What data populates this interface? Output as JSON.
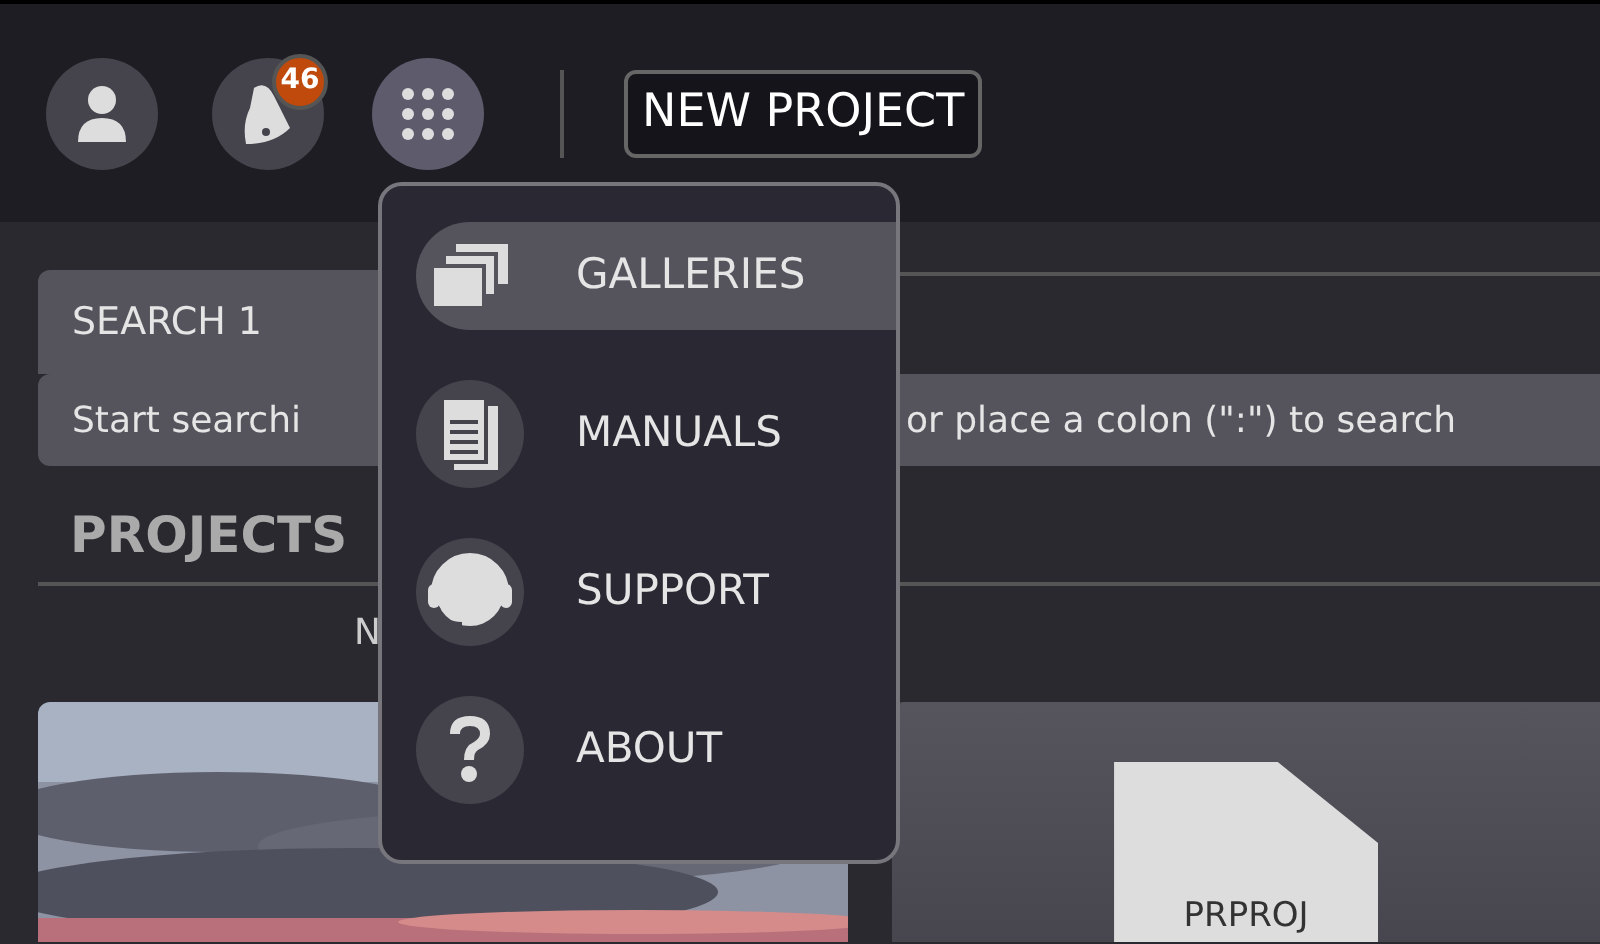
{
  "header": {
    "notification_count": "46",
    "new_project_button": "NEW PROJECT"
  },
  "search": {
    "tab": "SEARCH 1",
    "field_text_before": "Start searchi",
    "field_text_after": "or place a colon (\":\") to search"
  },
  "projects": {
    "heading": "PROJECTS",
    "column_1": "N",
    "cards": [
      {
        "kind": "picture"
      },
      {
        "kind": "file",
        "label": "PRPROJ"
      }
    ]
  },
  "apps_menu": {
    "items": [
      {
        "label": "GALLERIES",
        "kind": "galleries",
        "selected": true
      },
      {
        "label": "MANUALS",
        "kind": "manuals",
        "selected": false
      },
      {
        "label": "SUPPORT",
        "kind": "support",
        "selected": false
      },
      {
        "label": "ABOUT",
        "kind": "about",
        "selected": false
      }
    ]
  }
}
